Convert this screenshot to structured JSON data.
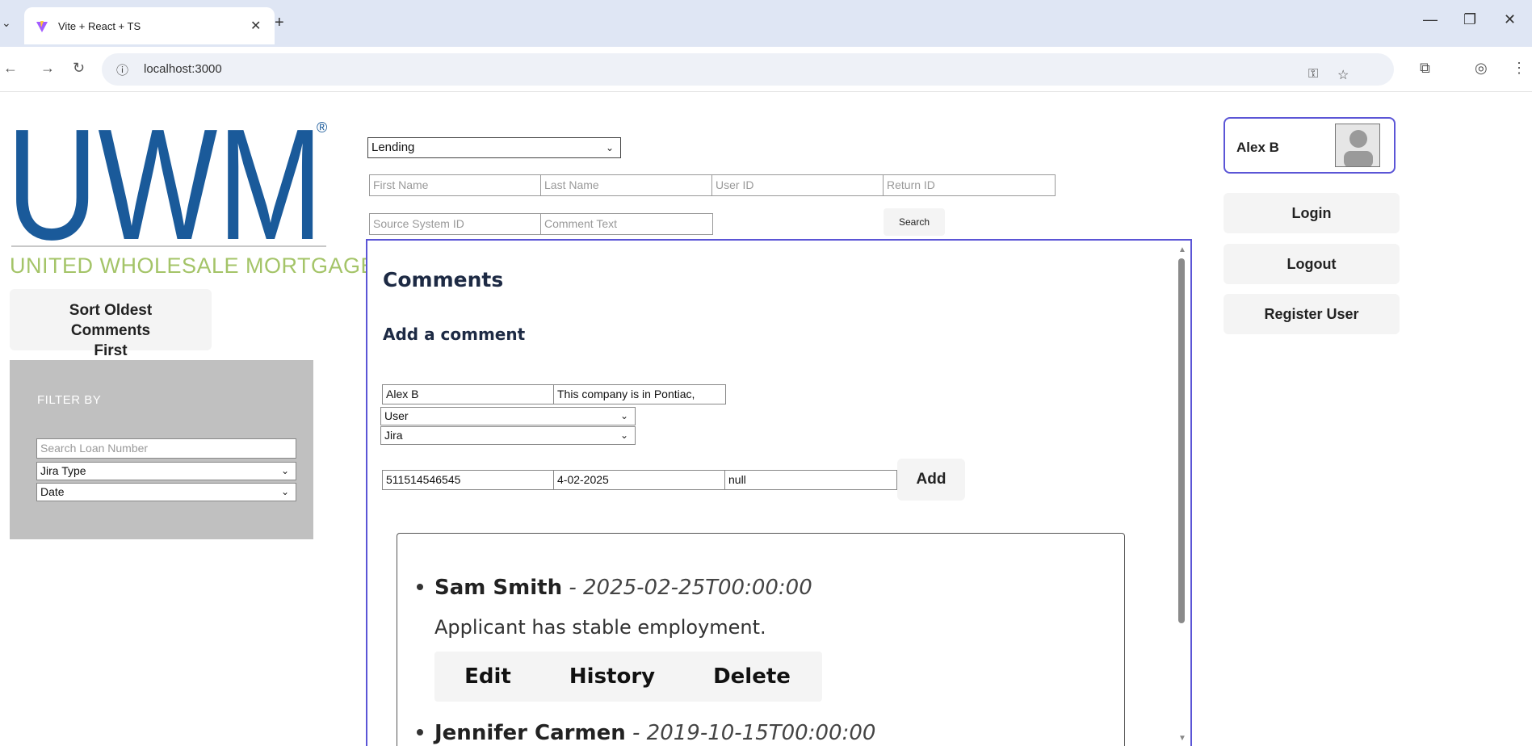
{
  "browser": {
    "tab_title": "Vite + React + TS",
    "url": "localhost:3000"
  },
  "logo": {
    "mark": "UWM",
    "registered": "®",
    "tagline": "UNITED WHOLESALE MORTGAGE"
  },
  "sidebar": {
    "sort_button": "Sort Oldest Comments First",
    "filter_title": "FILTER BY",
    "loan_search_placeholder": "Search Loan Number",
    "jira_type_value": "Jira Type",
    "date_value": "Date"
  },
  "search": {
    "category_value": "Lending",
    "first_name_placeholder": "First Name",
    "last_name_placeholder": "Last Name",
    "user_id_placeholder": "User ID",
    "return_id_placeholder": "Return ID",
    "source_system_placeholder": "Source System ID",
    "comment_text_placeholder": "Comment Text",
    "search_button": "Search"
  },
  "comments": {
    "title": "Comments",
    "add_title": "Add a comment",
    "form": {
      "author_value": "Alex B",
      "text_value": "This company is in Pontiac,",
      "role_value": "User",
      "type_value": "Jira",
      "loan_value": "511514546545",
      "date_value": "4-02-2025",
      "extra_value": "null",
      "add_button": "Add"
    },
    "items": [
      {
        "author": "Sam Smith",
        "date": " - 2025-02-25T00:00:00",
        "text": "Applicant has stable employment.",
        "edit": "Edit",
        "history": "History",
        "delete": "Delete"
      },
      {
        "author": "Jennifer Carmen",
        "date": " - 2019-10-15T00:00:00"
      }
    ]
  },
  "user_panel": {
    "name": "Alex B",
    "login": "Login",
    "logout": "Logout",
    "register": "Register User"
  },
  "colors": {
    "brand_blue": "#1a5a9a",
    "brand_green": "#a4c468",
    "accent_border": "#5b55d6"
  }
}
